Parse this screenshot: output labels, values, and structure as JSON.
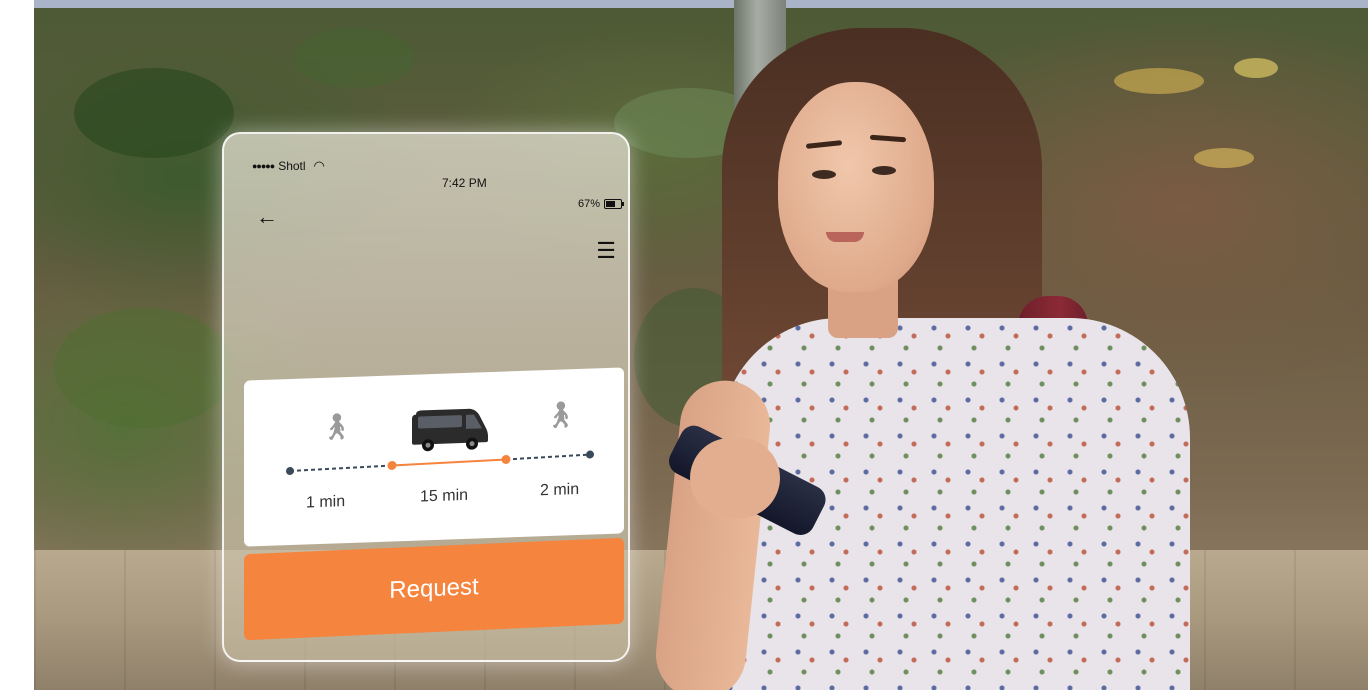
{
  "app": {
    "carrier": "Shotl",
    "time": "7:42 PM",
    "battery_percent": 67,
    "battery_label": "67%"
  },
  "trip": {
    "segments": [
      {
        "mode": "walk",
        "icon": "walking-person-icon",
        "duration": "1 min"
      },
      {
        "mode": "van",
        "icon": "van-icon",
        "duration": "15 min"
      },
      {
        "mode": "walk",
        "icon": "walking-person-icon",
        "duration": "2 min"
      }
    ]
  },
  "actions": {
    "request_label": "Request"
  },
  "colors": {
    "accent": "#f4843e",
    "route_active": "#f4843e",
    "route_inactive": "#3a4a5a"
  }
}
